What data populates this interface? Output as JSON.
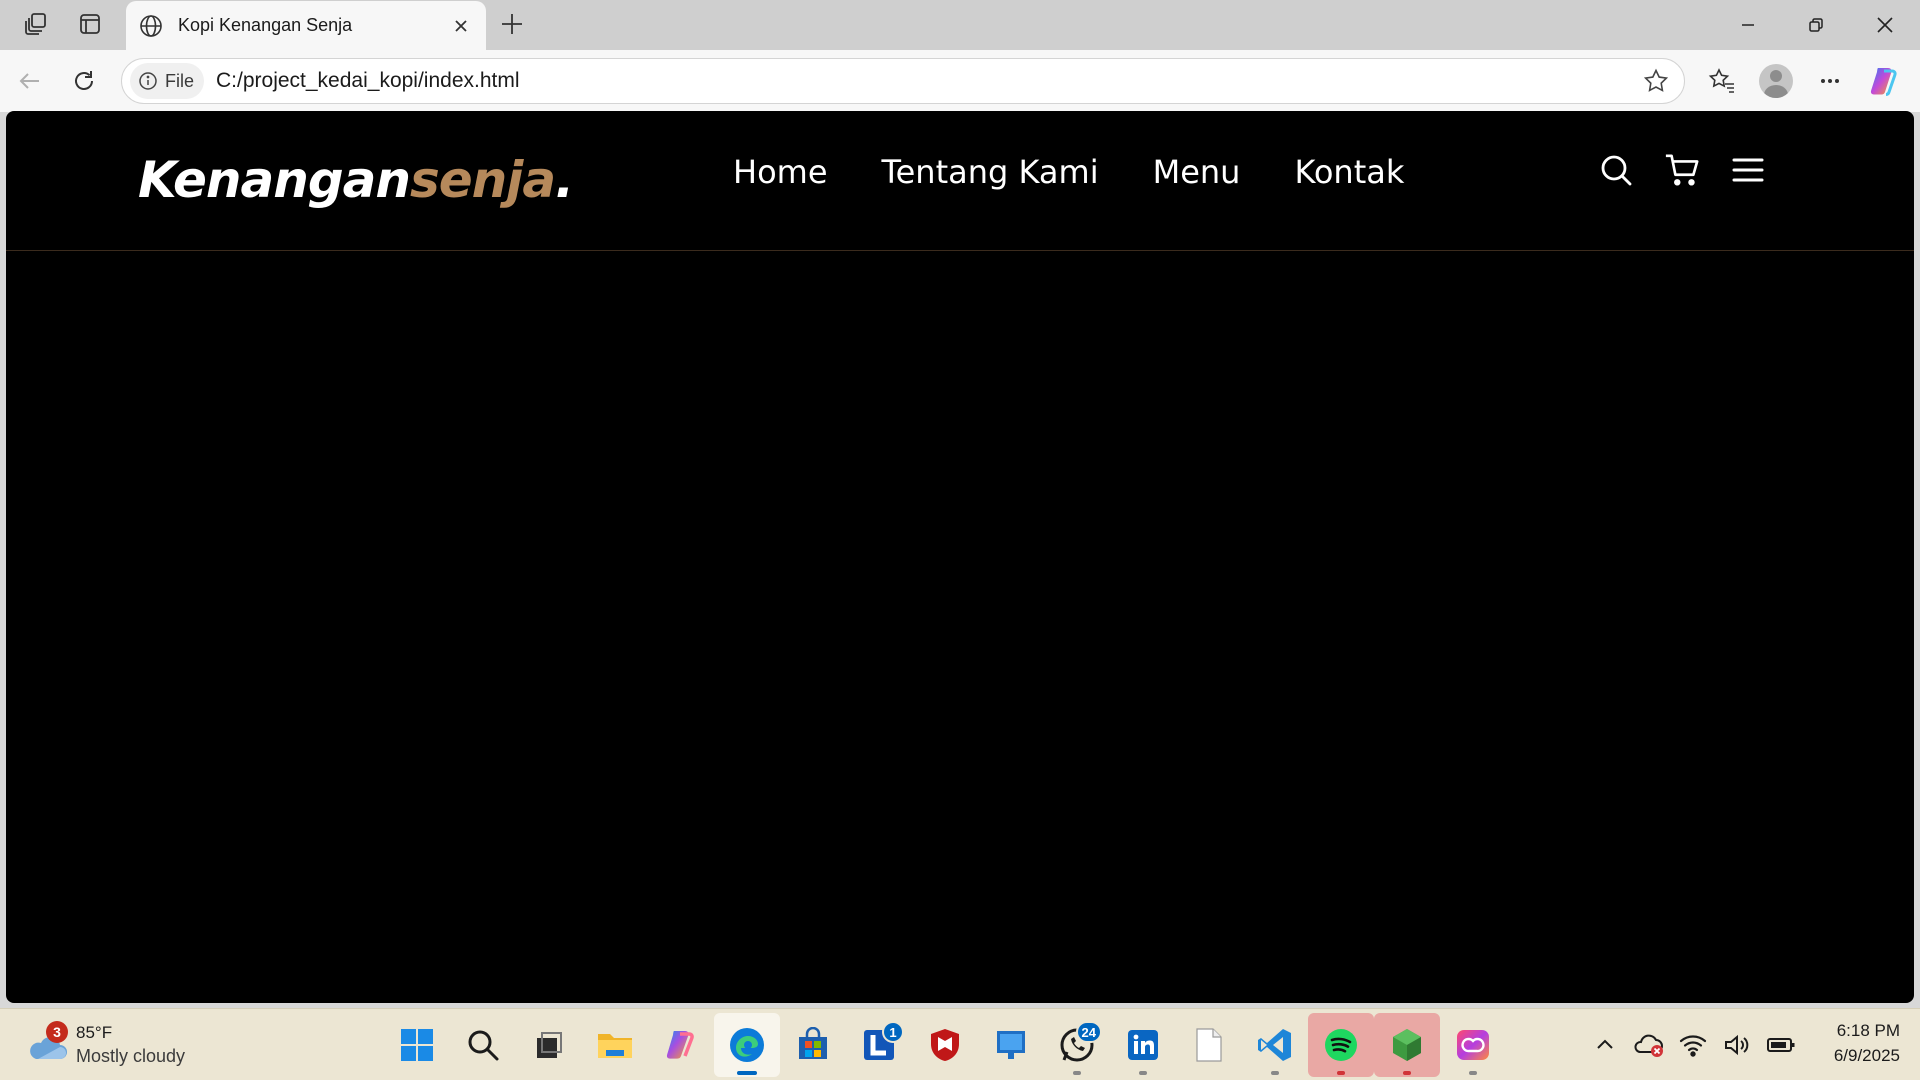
{
  "browser": {
    "tab": {
      "title": "Kopi Kenangan Senja",
      "icon": "globe-icon"
    },
    "address": {
      "scheme_label": "File",
      "url": "C:/project_kedai_kopi/index.html"
    }
  },
  "site": {
    "logo": {
      "main": "Kenangan",
      "accent": "senja",
      "dot": "."
    },
    "accent_color": "#b6895b",
    "nav_links": [
      "Home",
      "Tentang Kami",
      "Menu",
      "Kontak"
    ],
    "icons": [
      "search-icon",
      "shopping-cart-icon",
      "hamburger-menu-icon"
    ]
  },
  "taskbar": {
    "weather": {
      "badge": "3",
      "temperature": "85°F",
      "condition": "Mostly cloudy"
    },
    "apps": [
      {
        "name": "start-button"
      },
      {
        "name": "search-button"
      },
      {
        "name": "task-view-button"
      },
      {
        "name": "file-explorer"
      },
      {
        "name": "copilot"
      },
      {
        "name": "microsoft-edge",
        "active": true
      },
      {
        "name": "microsoft-store"
      },
      {
        "name": "launcher-l",
        "badge": "1"
      },
      {
        "name": "mcafee"
      },
      {
        "name": "blue-app"
      },
      {
        "name": "whatsapp",
        "badge": "24"
      },
      {
        "name": "linkedin"
      },
      {
        "name": "blank-document"
      },
      {
        "name": "visual-studio-code"
      },
      {
        "name": "spotify"
      },
      {
        "name": "green-cube-app"
      },
      {
        "name": "creative-cloud"
      }
    ],
    "clock": {
      "time": "6:18 PM",
      "date": "6/9/2025"
    }
  }
}
